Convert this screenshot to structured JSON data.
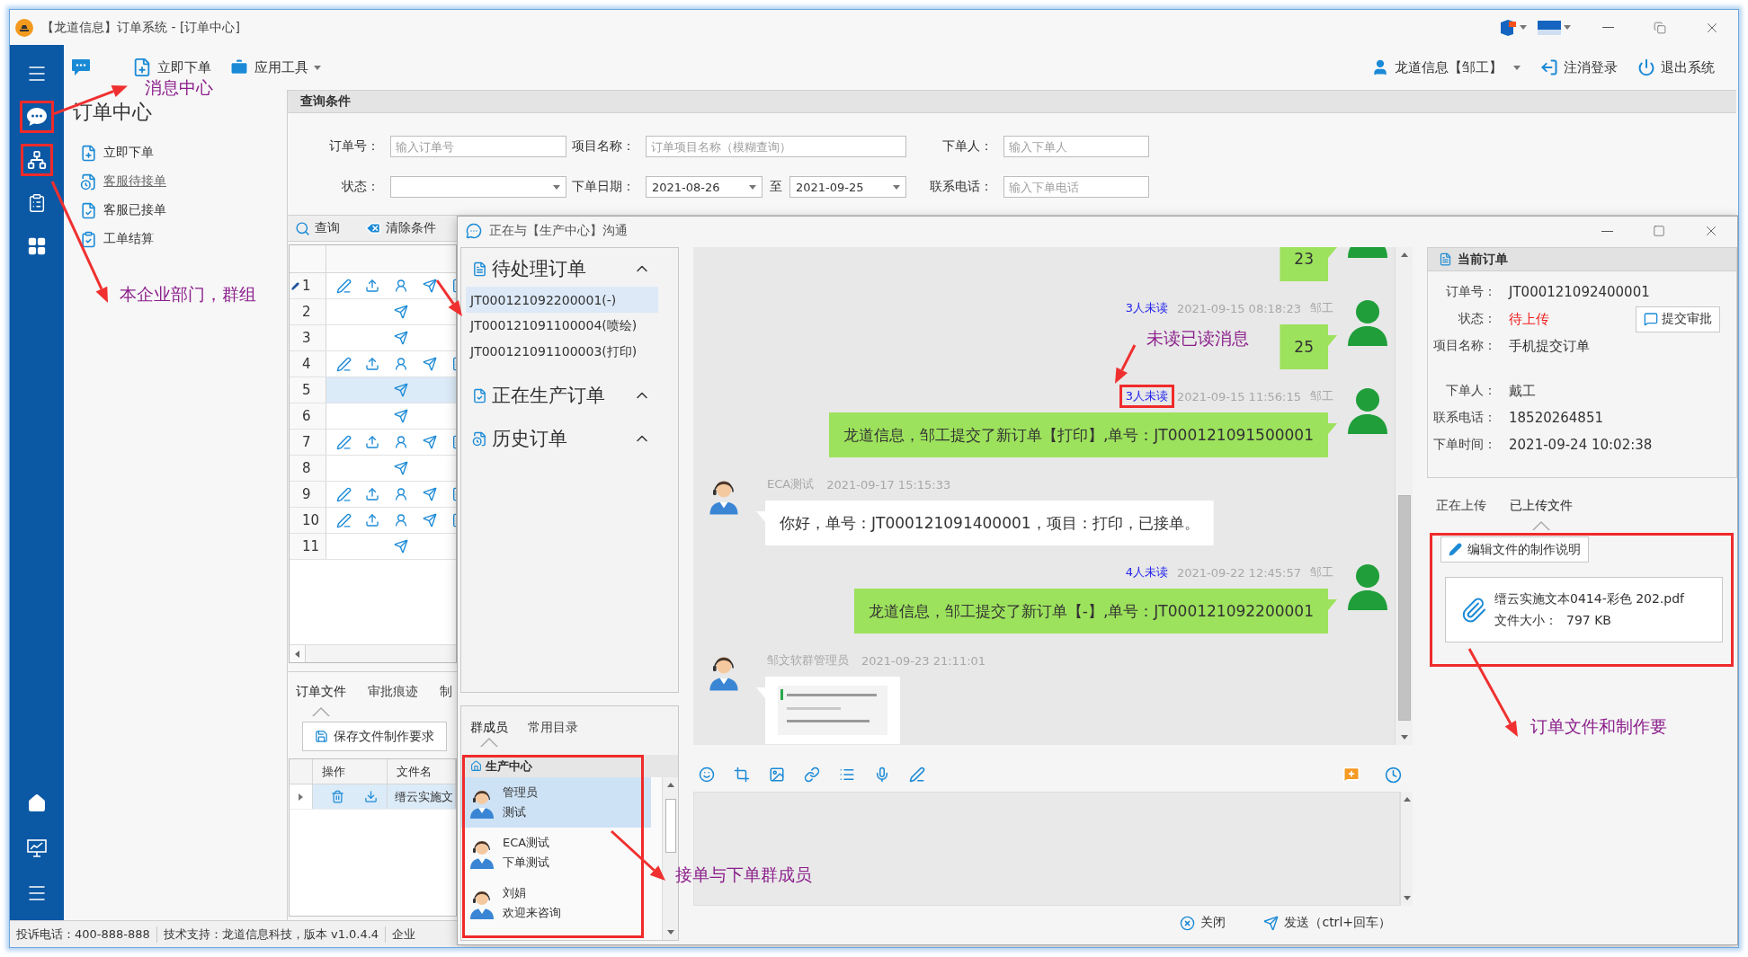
{
  "window": {
    "title": "【龙道信息】订单系统 - [订单中心]"
  },
  "nav_rail": {
    "top": [
      {
        "kind": "menu",
        "boxed": false
      },
      {
        "kind": "chat",
        "boxed": true
      },
      {
        "kind": "org",
        "boxed": true
      },
      {
        "kind": "list",
        "boxed": false
      },
      {
        "kind": "apps",
        "boxed": false
      }
    ],
    "bottom": [
      {
        "kind": "home"
      },
      {
        "kind": "monitor"
      },
      {
        "kind": "menu"
      }
    ]
  },
  "toolbar": {
    "items": [
      {
        "kind": "chat"
      },
      {
        "kind": "new_order",
        "label": "立即下单",
        "dropdown": false
      },
      {
        "kind": "tools",
        "label": "应用工具",
        "dropdown": true
      }
    ],
    "user": {
      "label": "龙道信息【邹工】",
      "dropdown": true
    },
    "actions": [
      {
        "kind": "logout",
        "label": "注消登录"
      },
      {
        "kind": "exit",
        "label": "退出系统"
      }
    ]
  },
  "side_menu": {
    "title": "订单中心",
    "items": [
      {
        "kind": "new",
        "label": "立即下单",
        "hovered": false
      },
      {
        "kind": "pending",
        "label": "客服待接单",
        "hovered": true
      },
      {
        "kind": "accepted",
        "label": "客服已接单",
        "hovered": false
      },
      {
        "kind": "settle",
        "label": "工单结算",
        "hovered": false
      }
    ]
  },
  "query": {
    "title": "查询条件",
    "rows": [
      [
        {
          "kind": "text",
          "label": "订单号：",
          "placeholder": "输入订单号"
        },
        {
          "kind": "text",
          "label": "项目名称：",
          "placeholder": "订单项目名称（模糊查询）"
        },
        {
          "kind": "text",
          "label": "下单人：",
          "placeholder": "输入下单人"
        }
      ],
      [
        {
          "kind": "select",
          "label": "状态："
        },
        {
          "kind": "date_range",
          "label": "下单日期：",
          "from": "2021-08-26",
          "separator": "至",
          "to": "2021-09-25"
        },
        {
          "kind": "text",
          "label": "联系电话：",
          "placeholder": "输入下单电话"
        }
      ]
    ],
    "buttons": [
      {
        "kind": "search",
        "label": "查询"
      },
      {
        "kind": "clear",
        "label": "清除条件"
      }
    ]
  },
  "orders_grid": {
    "rows": [
      {
        "number": "1",
        "kind": "full",
        "editing": true,
        "selected": false
      },
      {
        "number": "2",
        "kind": "send_only",
        "editing": false,
        "selected": false
      },
      {
        "number": "3",
        "kind": "send_only",
        "editing": false,
        "selected": false
      },
      {
        "number": "4",
        "kind": "full",
        "editing": false,
        "selected": false
      },
      {
        "number": "5",
        "kind": "send_only",
        "editing": false,
        "selected": true
      },
      {
        "number": "6",
        "kind": "send_only",
        "editing": false,
        "selected": false
      },
      {
        "number": "7",
        "kind": "full",
        "editing": false,
        "selected": false
      },
      {
        "number": "8",
        "kind": "send_only",
        "editing": false,
        "selected": false
      },
      {
        "number": "9",
        "kind": "full",
        "editing": false,
        "selected": false
      },
      {
        "number": "10",
        "kind": "full",
        "editing": false,
        "selected": false
      },
      {
        "number": "11",
        "kind": "send_only",
        "editing": false,
        "selected": false
      }
    ]
  },
  "detail_tabs": [
    {
      "label": "订单文件",
      "selected": true
    },
    {
      "label": "审批痕迹",
      "selected": false
    },
    {
      "label": "制",
      "selected": false
    }
  ],
  "save_button": "保存文件制作要求",
  "files_grid": {
    "columns": [
      "操作",
      "文件名"
    ],
    "rows": [
      {
        "file_name": "缙云实施文"
      }
    ]
  },
  "status_bar": [
    "投诉电话：400-888-888",
    "技术支持：龙道信息科技，版本 v1.0.4.4",
    "企业"
  ],
  "chat": {
    "title": "正在与【生产中心】沟通",
    "order_groups": [
      {
        "kind": "pending",
        "title": "待处理订单",
        "expanded": true,
        "items": [
          {
            "label": "JT000121092200001(-)",
            "selected": true
          },
          {
            "label": "JT000121091100004(喷绘)",
            "selected": false
          },
          {
            "label": "JT000121091100003(打印)",
            "selected": false
          }
        ]
      },
      {
        "kind": "producing",
        "title": "正在生产订单",
        "expanded": true
      },
      {
        "kind": "history",
        "title": "历史订单",
        "expanded": true
      }
    ],
    "member_tabs": [
      {
        "label": "群成员",
        "selected": true
      },
      {
        "label": "常用目录",
        "selected": false
      }
    ],
    "members": {
      "group": "生产中心",
      "boxed": true,
      "items": [
        {
          "name": "管理员",
          "status": "测试",
          "selected": true
        },
        {
          "name": "ECA测试",
          "status": "下单测试",
          "selected": false
        },
        {
          "name": "刘娟",
          "status": "欢迎来咨询",
          "selected": false
        }
      ]
    },
    "messages": [
      {
        "kind": "sent",
        "text": "23"
      },
      {
        "kind": "sent",
        "unread": "3人未读",
        "time": "2021-09-15 08:18:23",
        "sender": "邹工",
        "text": "25",
        "boxed": false
      },
      {
        "kind": "sent",
        "unread": "3人未读",
        "time": "2021-09-15 11:56:15",
        "sender": "邹工",
        "text": "龙道信息，邹工提交了新订单【打印】,单号：JT000121091500001",
        "boxed": true
      },
      {
        "kind": "received",
        "sender": "ECA测试",
        "time": "2021-09-17 15:15:33",
        "text": "你好，单号：JT000121091400001，项目：打印，已接单。"
      },
      {
        "kind": "sent",
        "unread": "4人未读",
        "time": "2021-09-22 12:45:57",
        "sender": "邹工",
        "text": "龙道信息，邹工提交了新订单【-】,单号：JT000121092200001",
        "boxed": false
      },
      {
        "kind": "received_image",
        "sender": "邹文软群管理员",
        "time": "2021-09-23 21:11:01"
      }
    ],
    "footer_buttons": [
      {
        "kind": "close",
        "label": "关闭"
      },
      {
        "kind": "send",
        "label": "发送（ctrl+回车）"
      }
    ],
    "current_order": {
      "title": "当前订单",
      "submit_button": "提交审批",
      "field_groups": [
        [
          {
            "label": "订单号：",
            "value": "JT000121092400001",
            "kind": "plain"
          },
          {
            "label": "状态：",
            "value": "待上传",
            "kind": "status"
          },
          {
            "label": "项目名称：",
            "value": "手机提交订单",
            "kind": "plain"
          }
        ],
        [
          {
            "label": "下单人：",
            "value": "戴工",
            "kind": "plain"
          },
          {
            "label": "联系电话：",
            "value": "18520264851",
            "kind": "plain"
          },
          {
            "label": "下单时间：",
            "value": "2021-09-24 10:02:38",
            "kind": "plain"
          }
        ]
      ]
    },
    "file_tabs": [
      {
        "label": "正在上传",
        "selected": false
      },
      {
        "label": "已上传文件",
        "selected": true
      }
    ],
    "uploaded": {
      "boxed": true,
      "edit_button": "编辑文件的制作说明",
      "files": [
        {
          "name": "缙云实施文本0414-彩色 202.pdf",
          "size_label": "文件大小：",
          "size": "797 KB"
        }
      ]
    }
  },
  "annotations": {
    "message_center": "消息中心",
    "departments": "本企业部门，群组",
    "read_status": "未读已读消息",
    "members": "接单与下单群成员",
    "order_files": "订单文件和制作要"
  }
}
